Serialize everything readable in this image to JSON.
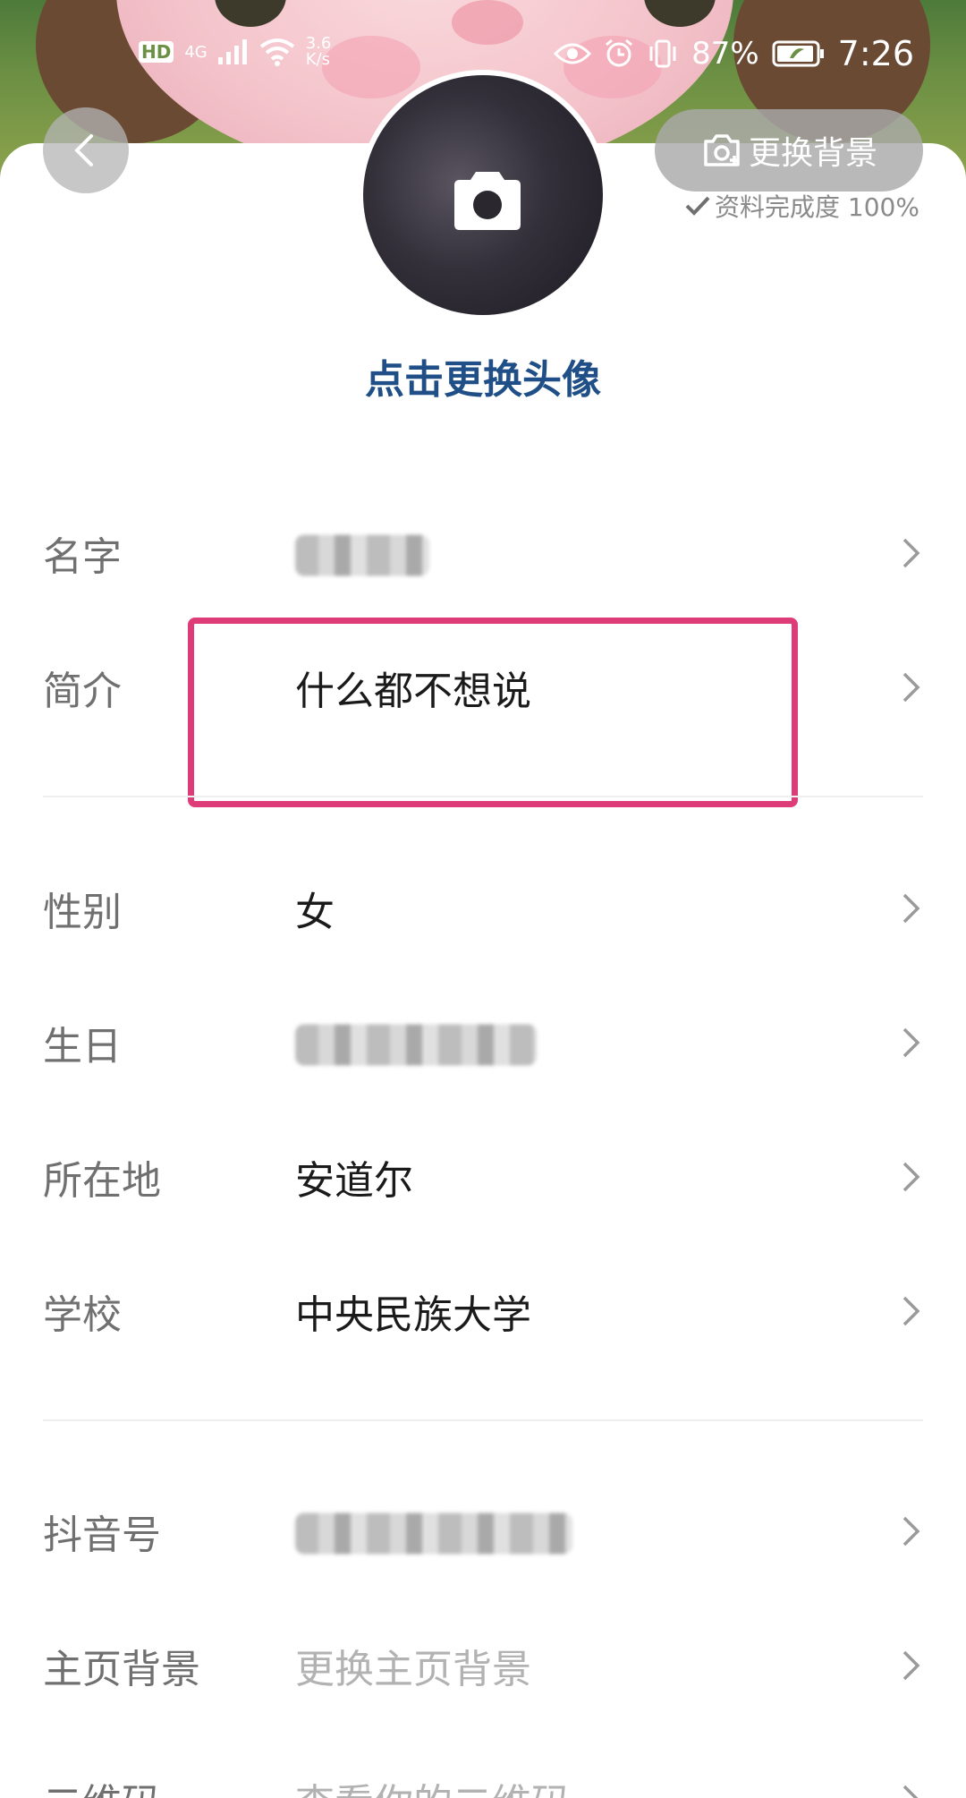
{
  "status_bar": {
    "hd": "HD",
    "network": "4G",
    "speed_top": "3.6",
    "speed_bottom": "K/s",
    "battery": "87%",
    "time": "7:26"
  },
  "header": {
    "change_background": "更换背景",
    "completion": "资料完成度 100%"
  },
  "avatar": {
    "change_label": "点击更换头像"
  },
  "profile": [
    {
      "id": "name",
      "label": "名字",
      "value": "",
      "blurred": true
    },
    {
      "id": "bio",
      "label": "简介",
      "value": "什么都不想说"
    },
    {
      "id": "gender",
      "label": "性别",
      "value": "女"
    },
    {
      "id": "birthday",
      "label": "生日",
      "value": "",
      "blurred": true
    },
    {
      "id": "location",
      "label": "所在地",
      "value": "安道尔"
    },
    {
      "id": "school",
      "label": "学校",
      "value": "中央民族大学"
    },
    {
      "id": "douyin-id",
      "label": "抖音号",
      "value": "",
      "blurred": true
    },
    {
      "id": "home-background",
      "label": "主页背景",
      "value": "更换主页背景"
    },
    {
      "id": "qr-code",
      "label": "二维码",
      "value": "查看你的二维码"
    }
  ],
  "colors": {
    "accent_blue": "#1f4f86",
    "highlight_pink": "#dd3c78",
    "label_gray": "#707070",
    "placeholder_gray": "#b2b2b2"
  }
}
